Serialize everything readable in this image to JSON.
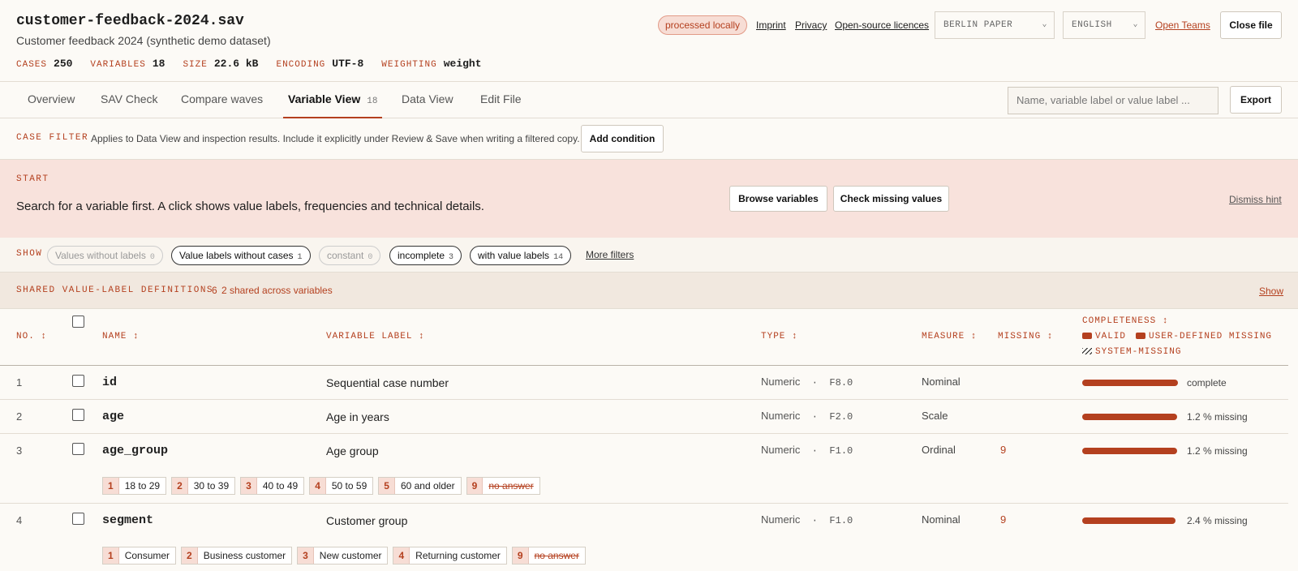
{
  "header": {
    "file_name": "customer-feedback-2024.sav",
    "subtitle": "Customer feedback 2024 (synthetic demo dataset)",
    "meta": [
      {
        "key": "CASES",
        "value": "250"
      },
      {
        "key": "VARIABLES",
        "value": "18"
      },
      {
        "key": "SIZE",
        "value": "22.6 kB"
      },
      {
        "key": "ENCODING",
        "value": "UTF-8"
      },
      {
        "key": "WEIGHTING",
        "value": "weight"
      }
    ],
    "local_badge": "processed locally",
    "links": {
      "imprint": "Imprint",
      "privacy": "Privacy",
      "licences": "Open-source licences"
    },
    "theme_select": "BERLIN PAPER",
    "language_select": "ENGLISH",
    "open_teams": "Open Teams",
    "close_file": "Close file"
  },
  "tabs": [
    {
      "label": "Overview"
    },
    {
      "label": "SAV Check"
    },
    {
      "label": "Compare waves"
    },
    {
      "label": "Variable View",
      "count": "18"
    },
    {
      "label": "Data View"
    },
    {
      "label": "Edit File"
    }
  ],
  "search": {
    "placeholder": "Name, variable label or value label ..."
  },
  "export_label": "Export",
  "case_filter": {
    "key": "CASE FILTER",
    "text": "Applies to Data View and inspection results. Include it explicitly under Review & Save when writing a filtered copy.",
    "add_condition": "Add condition"
  },
  "start": {
    "key": "START",
    "text": "Search for a variable first. A click shows value labels, frequencies and technical details.",
    "browse": "Browse variables",
    "check_missing": "Check missing values",
    "dismiss": "Dismiss hint"
  },
  "show": {
    "key": "SHOW",
    "chips": [
      {
        "label": "Values without labels",
        "count": "0"
      },
      {
        "label": "Value labels without cases",
        "count": "1"
      },
      {
        "label": "constant",
        "count": "0"
      },
      {
        "label": "incomplete",
        "count": "3"
      },
      {
        "label": "with value labels",
        "count": "14"
      }
    ],
    "more_filters": "More filters"
  },
  "shared": {
    "key": "SHARED VALUE-LABEL DEFINITIONS",
    "count": "6",
    "text": "2 shared across variables",
    "show_link": "Show"
  },
  "table": {
    "headers": {
      "no": "NO. ↕",
      "name": "NAME ↕",
      "label": "VARIABLE LABEL ↕",
      "type": "TYPE ↕",
      "measure": "MEASURE ↕",
      "missing": "MISSING ↕",
      "completeness": "COMPLETENESS ↕",
      "legend_valid": "VALID",
      "legend_user": "USER-DEFINED MISSING",
      "legend_system": "SYSTEM-MISSING"
    },
    "rows": [
      {
        "no": "1",
        "name": "id",
        "label": "Sequential case number",
        "type": "Numeric",
        "format": "F8.0",
        "measure": "Nominal",
        "missing": "",
        "complete": 1.0,
        "complete_text": "complete",
        "value_labels": []
      },
      {
        "no": "2",
        "name": "age",
        "label": "Age in years",
        "type": "Numeric",
        "format": "F2.0",
        "measure": "Scale",
        "missing": "",
        "complete": 0.988,
        "complete_text": "1.2 % missing",
        "value_labels": []
      },
      {
        "no": "3",
        "name": "age_group",
        "label": "Age group",
        "type": "Numeric",
        "format": "F1.0",
        "measure": "Ordinal",
        "missing": "9",
        "complete": 0.988,
        "complete_text": "1.2 % missing",
        "value_labels": [
          {
            "code": "1",
            "label": "18 to 29"
          },
          {
            "code": "2",
            "label": "30 to 39"
          },
          {
            "code": "3",
            "label": "40 to 49"
          },
          {
            "code": "4",
            "label": "50 to 59"
          },
          {
            "code": "5",
            "label": "60 and older"
          },
          {
            "code": "9",
            "label": "no answer",
            "missing": true
          }
        ]
      },
      {
        "no": "4",
        "name": "segment",
        "label": "Customer group",
        "type": "Numeric",
        "format": "F1.0",
        "measure": "Nominal",
        "missing": "9",
        "complete": 0.976,
        "complete_text": "2.4 % missing",
        "value_labels": [
          {
            "code": "1",
            "label": "Consumer"
          },
          {
            "code": "2",
            "label": "Business customer"
          },
          {
            "code": "3",
            "label": "New customer"
          },
          {
            "code": "4",
            "label": "Returning customer"
          },
          {
            "code": "9",
            "label": "no answer",
            "missing": true
          }
        ]
      }
    ]
  },
  "colors": {
    "accent": "#b4401f",
    "hint_bg": "#f8e2dc",
    "paper": "#fcfaf6"
  }
}
